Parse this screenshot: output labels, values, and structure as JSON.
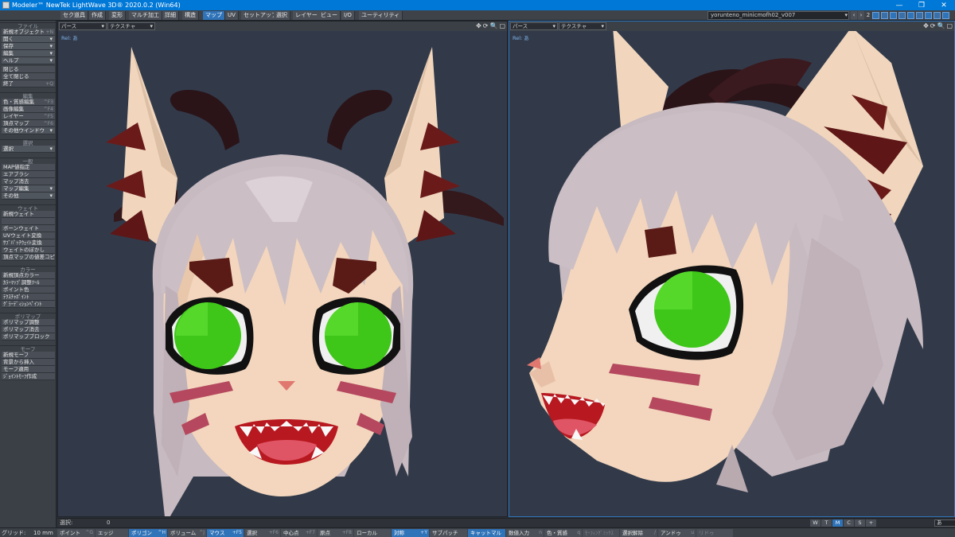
{
  "titlebar": {
    "title": "Modeler™ NewTek LightWave 3D® 2020.0.2 (Win64)",
    "minimize": "—",
    "maximize": "❐",
    "close": "✕"
  },
  "tabs": [
    {
      "label": "セク道具"
    },
    {
      "label": "作成"
    },
    {
      "label": "変形"
    },
    {
      "label": "マルチ加工"
    },
    {
      "label": "詳細"
    },
    {
      "label": "構造"
    },
    {
      "label": "マップ",
      "active": true
    },
    {
      "label": "UV"
    },
    {
      "label": "セットアップ"
    },
    {
      "label": "選択"
    },
    {
      "label": "レイヤー"
    },
    {
      "label": "ビュー"
    },
    {
      "label": "I/O"
    },
    {
      "label": "ユーティリティ"
    }
  ],
  "scene": {
    "name": "yorunteno_minicmofh02_v007",
    "layer_num": "2"
  },
  "sidebar": {
    "groups": [
      {
        "head": "ファイル",
        "items": [
          {
            "label": "新規オブジェクト",
            "shortcut": "+N"
          },
          {
            "label": "開く",
            "dropdown": true
          },
          {
            "label": "保存",
            "dropdown": true
          },
          {
            "label": "編集",
            "dropdown": true
          },
          {
            "label": "ヘルプ",
            "dropdown": true
          },
          {
            "label": "閉じる"
          },
          {
            "label": "全て閉じる"
          },
          {
            "label": "終了",
            "shortcut": "+Q"
          }
        ]
      },
      {
        "head": "編集",
        "items": [
          {
            "label": "色・質感編集",
            "shortcut": "^F3"
          },
          {
            "label": "画像編集",
            "shortcut": "^F4"
          },
          {
            "label": "レイヤー",
            "shortcut": "^F5"
          },
          {
            "label": "頂点マップ",
            "shortcut": "^F6"
          },
          {
            "label": "その他ウインドウ",
            "dropdown": true
          }
        ]
      },
      {
        "head": "選択",
        "items": [
          {
            "label": "選択",
            "dropdown": true
          }
        ]
      },
      {
        "head": "一般",
        "items": [
          {
            "label": "MAP値指定"
          },
          {
            "label": "エアブラシ"
          },
          {
            "label": "マップ消去"
          },
          {
            "label": "マップ編集",
            "dropdown": true
          },
          {
            "label": "その他",
            "dropdown": true
          }
        ]
      },
      {
        "head": "ウェイト",
        "items": [
          {
            "label": "新規ウェイト"
          },
          {
            "label": "",
            "dim": true
          },
          {
            "label": "ボーンウェイト"
          },
          {
            "label": "UVウェイト変換"
          },
          {
            "label": "ｻﾌﾞﾊﾟｯﾁｳｪｲﾄ変換"
          },
          {
            "label": "ウェイトのぼかし"
          },
          {
            "label": "頂点マップの値差コピー"
          }
        ]
      },
      {
        "head": "カラー",
        "items": [
          {
            "label": "新規頂点カラー"
          },
          {
            "label": "ｶﾗｰﾏｯﾌﾟ調整ﾂｰﾙ"
          },
          {
            "label": "ポイント色"
          },
          {
            "label": "ﾃｸｽﾁｬﾎﾟｲﾝﾄ"
          },
          {
            "label": "ｸﾞﾗｰﾃﾞｨｼｮﾝﾍﾟｲﾝﾄ"
          }
        ]
      },
      {
        "head": "ポリマップ",
        "items": [
          {
            "label": "ポリマップ調整"
          },
          {
            "label": "ポリマップ消去"
          },
          {
            "label": "ポリマップブロック"
          }
        ]
      },
      {
        "head": "モーフ",
        "items": [
          {
            "label": "新規モーフ"
          },
          {
            "label": "背景から挿入"
          },
          {
            "label": "モーフ適用"
          },
          {
            "label": "ｼﾞｮｲﾝﾄﾓｰﾌ作成"
          }
        ]
      }
    ]
  },
  "viewports": [
    {
      "projection": "パース",
      "shading": "テクスチャ",
      "label": "Rel: あ"
    },
    {
      "projection": "パース",
      "shading": "テクスチャ",
      "label": "Rel: あ"
    }
  ],
  "viewport_tools": {
    "move": "✥",
    "rotate": "⟳",
    "zoom": "🔍",
    "max": "▢"
  },
  "status": {
    "select_label": "選択:",
    "select_value": "0",
    "view_buttons": [
      "W",
      "T",
      "M",
      "C",
      "S",
      "+"
    ],
    "view_active": "M",
    "layer_dropdown": "あ"
  },
  "bottom": {
    "grid_label": "グリッド:",
    "grid_value": "10 mm",
    "buttons": [
      {
        "label": "ポイント",
        "shortcut": "^G"
      },
      {
        "label": "エッジ",
        "shortcut": ""
      },
      {
        "label": "ポリゴン",
        "shortcut": "^H",
        "on": true
      },
      {
        "label": "ボリューム",
        "shortcut": "^J"
      },
      {
        "label": "マウス",
        "shortcut": "+F5",
        "on": true
      },
      {
        "label": "選択",
        "shortcut": "+F6"
      },
      {
        "label": "中心点",
        "shortcut": "+F7"
      },
      {
        "label": "原点",
        "shortcut": "+F8"
      },
      {
        "label": "ローカル",
        "shortcut": ""
      },
      {
        "label": "対称",
        "shortcut": "+Y",
        "on": true
      },
      {
        "label": "サブパッチ",
        "shortcut": ""
      },
      {
        "label": "キャットマル",
        "shortcut": "",
        "on": true
      },
      {
        "label": "数値入力",
        "shortcut": "n"
      },
      {
        "label": "色・質感",
        "shortcut": "q"
      },
      {
        "label": "ﾓｰﾌｨﾝｸﾞﾐｯｸｽ",
        "shortcut": "",
        "dim": true
      },
      {
        "label": "選択解除",
        "shortcut": "/"
      },
      {
        "label": "アンドゥ",
        "shortcut": "u"
      },
      {
        "label": "リドゥ",
        "shortcut": "",
        "dim": true
      }
    ]
  },
  "colors": {
    "accent": "#2f73b8",
    "viewport_bg": "#323a4a",
    "skin": "#f3d6bd",
    "hair": "#c9bcc2",
    "eye": "#3ec619",
    "horn": "#2a1418",
    "stripe": "#b5485e"
  }
}
